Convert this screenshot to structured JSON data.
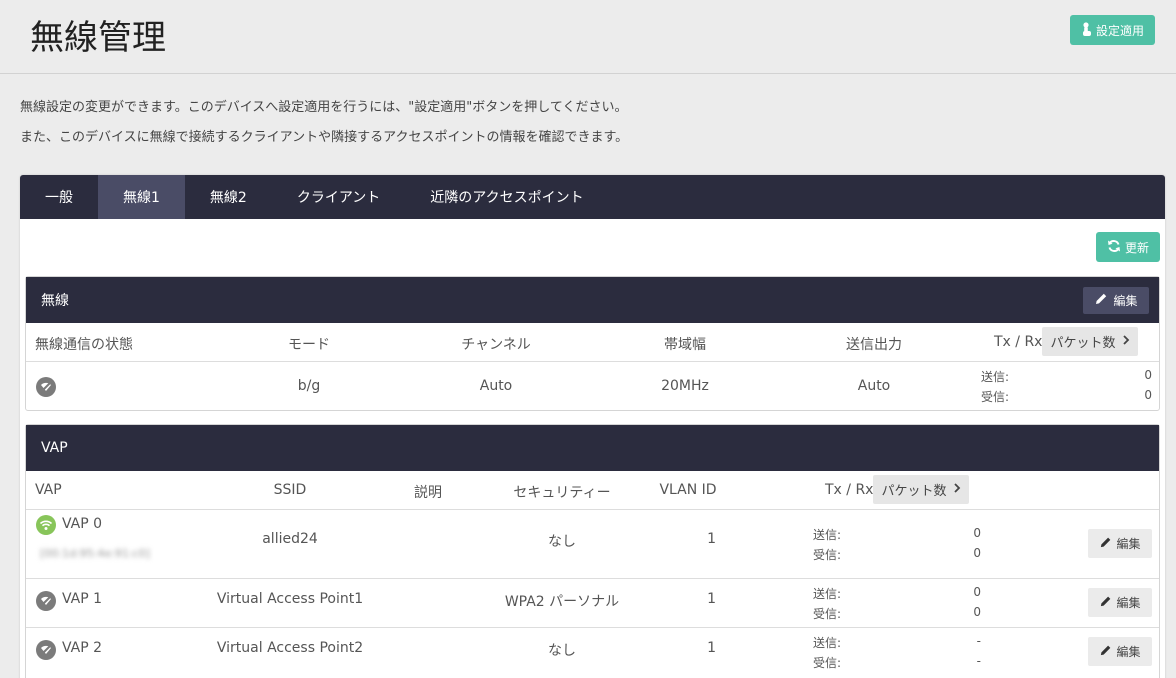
{
  "header": {
    "title": "無線管理",
    "apply_label": "設定適用"
  },
  "description": {
    "line1": "無線設定の変更ができます。このデバイスへ設定適用を行うには、\"設定適用\"ボタンを押してください。",
    "line2": "また、このデバイスに無線で接続するクライアントや隣接するアクセスポイントの情報を確認できます。"
  },
  "tabs": [
    {
      "label": "一般"
    },
    {
      "label": "無線1"
    },
    {
      "label": "無線2"
    },
    {
      "label": "クライアント"
    },
    {
      "label": "近隣のアクセスポイント"
    }
  ],
  "refresh_label": "更新",
  "radio_panel": {
    "title": "無線",
    "edit_label": "編集",
    "columns": {
      "status": "無線通信の状態",
      "mode": "モード",
      "channel": "チャンネル",
      "bandwidth": "帯域幅",
      "tx_power": "送信出力",
      "txrx": "Tx / Rx",
      "packets": "パケット数"
    },
    "row": {
      "status_icon": "wifi-off-icon",
      "mode": "b/g",
      "channel": "Auto",
      "bandwidth": "20MHz",
      "tx_power": "Auto",
      "send_label": "送信:",
      "send_value": "0",
      "recv_label": "受信:",
      "recv_value": "0"
    }
  },
  "vap_panel": {
    "title": "VAP",
    "columns": {
      "vap": "VAP",
      "ssid": "SSID",
      "desc": "説明",
      "security": "セキュリティー",
      "vlan": "VLAN ID",
      "txrx": "Tx / Rx",
      "packets": "パケット数"
    },
    "rows": [
      {
        "name": "VAP 0",
        "mac": "[00:1d:95:4e:91:c0]",
        "status_icon": "wifi-on-icon",
        "ssid": "allied24",
        "desc": "",
        "security": "なし",
        "vlan": "1",
        "send_label": "送信:",
        "send": "0",
        "recv_label": "受信:",
        "recv": "0",
        "edit_label": "編集"
      },
      {
        "name": "VAP 1",
        "mac": "",
        "status_icon": "wifi-off-icon",
        "ssid": "Virtual Access Point1",
        "desc": "",
        "security": "WPA2 パーソナル",
        "vlan": "1",
        "send_label": "送信:",
        "send": "0",
        "recv_label": "受信:",
        "recv": "0",
        "edit_label": "編集"
      },
      {
        "name": "VAP 2",
        "mac": "",
        "status_icon": "wifi-off-icon",
        "ssid": "Virtual Access Point2",
        "desc": "",
        "security": "なし",
        "vlan": "1",
        "send_label": "送信:",
        "send": "-",
        "recv_label": "受信:",
        "recv": "-",
        "edit_label": "編集"
      }
    ]
  },
  "colors": {
    "accent": "#4fc0a5",
    "dark": "#2b2c3e",
    "active_tab": "#4a4c66",
    "wifi_on": "#88c55a",
    "wifi_off": "#7b7b7b"
  }
}
